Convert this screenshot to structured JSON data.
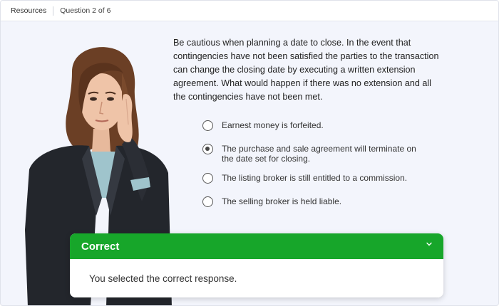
{
  "topbar": {
    "resources_label": "Resources",
    "progress_label": "Question 2 of 6"
  },
  "question": {
    "text": "Be cautious when planning a date to close. In the event that contingencies have not been satisfied the parties to the transaction can change the closing date by executing a written extension agreement. What would happen if there was no extension and all the contingencies have not been met."
  },
  "options": [
    {
      "label": "Earnest money is forfeited.",
      "selected": false
    },
    {
      "label": "The purchase and sale agreement will terminate on the date set for closing.",
      "selected": true
    },
    {
      "label": "The listing broker is still entitled to a commission.",
      "selected": false
    },
    {
      "label": "The selling broker is held liable.",
      "selected": false
    }
  ],
  "feedback": {
    "title": "Correct",
    "message": "You selected the correct response.",
    "header_color": "#17a62a",
    "toggle_icon": "chevron-down-icon"
  }
}
